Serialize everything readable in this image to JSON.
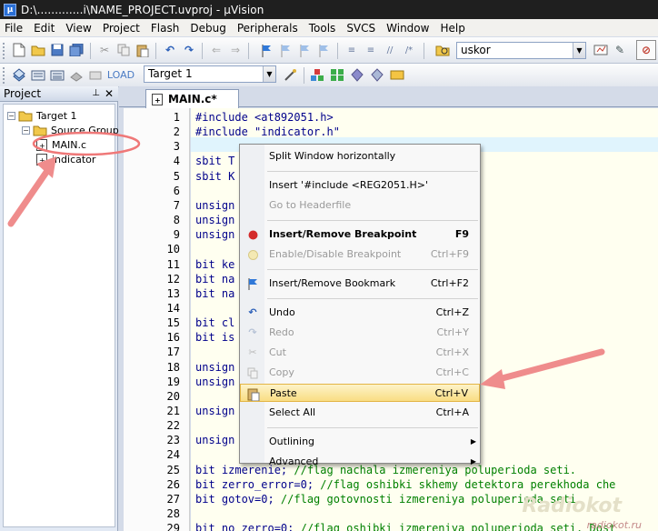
{
  "window": {
    "title": "D:\\.............i\\NAME_PROJECT.uvproj - µVision",
    "app_icon": "µ"
  },
  "menu": [
    "File",
    "Edit",
    "View",
    "Project",
    "Flash",
    "Debug",
    "Peripherals",
    "Tools",
    "SVCS",
    "Window",
    "Help"
  ],
  "toolbar": {
    "search_value": "uskor",
    "target_value": "Target 1"
  },
  "project_pane": {
    "title": "Project",
    "tree": [
      {
        "label": "Target 1",
        "level": 0
      },
      {
        "label": "Source Group",
        "level": 1
      },
      {
        "label": "MAIN.c",
        "level": 2
      },
      {
        "label": "indicator",
        "level": 2
      }
    ]
  },
  "editor": {
    "tab": "MAIN.c*",
    "lines": [
      {
        "n": "1",
        "code": "#include <at892051.h>",
        "comment": ""
      },
      {
        "n": "2",
        "code": "#include \"indicator.h\"",
        "comment": ""
      },
      {
        "n": "3",
        "code": "",
        "comment": ""
      },
      {
        "n": "4",
        "code": "sbit T",
        "comment": ""
      },
      {
        "n": "5",
        "code": "sbit K",
        "comment": ""
      },
      {
        "n": "6",
        "code": "",
        "comment": ""
      },
      {
        "n": "7",
        "code": "unsign",
        "comment": ""
      },
      {
        "n": "8",
        "code": "unsign",
        "comment": ""
      },
      {
        "n": "9",
        "code": "unsign",
        "comment": ""
      },
      {
        "n": "10",
        "code": "",
        "comment": ""
      },
      {
        "n": "11",
        "code": "bit ke",
        "comment": ""
      },
      {
        "n": "12",
        "code": "bit na",
        "comment": ""
      },
      {
        "n": "13",
        "code": "bit na",
        "comment": ""
      },
      {
        "n": "14",
        "code": "",
        "comment": ""
      },
      {
        "n": "15",
        "code": "bit cl",
        "comment": ""
      },
      {
        "n": "16",
        "code": "bit is",
        "comment": ""
      },
      {
        "n": "17",
        "code": "",
        "comment": ""
      },
      {
        "n": "18",
        "code": "unsign",
        "comment": ""
      },
      {
        "n": "19",
        "code": "unsign",
        "comment": ""
      },
      {
        "n": "20",
        "code": "",
        "comment": ""
      },
      {
        "n": "21",
        "code": "unsign",
        "comment": ""
      },
      {
        "n": "22",
        "code": "",
        "comment": ""
      },
      {
        "n": "23",
        "code": "unsign",
        "comment": ""
      },
      {
        "n": "24",
        "code": "",
        "comment": ""
      },
      {
        "n": "25",
        "code": "bit izmerenie; ",
        "comment": "//flag nachala izmereniya poluperioda seti."
      },
      {
        "n": "26",
        "code": "bit zerro_error=0; ",
        "comment": "//flag oshibki skhemy detektora perekhoda che"
      },
      {
        "n": "27",
        "code": "bit gotov=0; ",
        "comment": "//flag gotovnosti izmereniya poluperioda seti."
      },
      {
        "n": "28",
        "code": "",
        "comment": ""
      },
      {
        "n": "29",
        "code": "bit no_zerro=0; ",
        "comment": "//flag oshibki izmereniya poluperioda seti. Dost"
      }
    ]
  },
  "context_menu": [
    {
      "label": "Split Window horizontally",
      "shortcut": "",
      "disabled": false,
      "bold": false,
      "icon": ""
    },
    {
      "sep": true
    },
    {
      "label": "Insert '#include <REG2051.H>'",
      "shortcut": "",
      "disabled": false,
      "bold": false,
      "icon": ""
    },
    {
      "label": "Go to Headerfile",
      "shortcut": "",
      "disabled": true,
      "bold": false,
      "icon": ""
    },
    {
      "sep": true
    },
    {
      "label": "Insert/Remove Breakpoint",
      "shortcut": "F9",
      "disabled": false,
      "bold": true,
      "icon": "breakpoint-icon"
    },
    {
      "label": "Enable/Disable Breakpoint",
      "shortcut": "Ctrl+F9",
      "disabled": true,
      "bold": false,
      "icon": "breakpoint-disabled-icon"
    },
    {
      "sep": true
    },
    {
      "label": "Insert/Remove Bookmark",
      "shortcut": "Ctrl+F2",
      "disabled": false,
      "bold": false,
      "icon": "bookmark-flag-icon"
    },
    {
      "sep": true
    },
    {
      "label": "Undo",
      "shortcut": "Ctrl+Z",
      "disabled": false,
      "bold": false,
      "icon": "undo-icon"
    },
    {
      "label": "Redo",
      "shortcut": "Ctrl+Y",
      "disabled": true,
      "bold": false,
      "icon": "redo-icon"
    },
    {
      "label": "Cut",
      "shortcut": "Ctrl+X",
      "disabled": true,
      "bold": false,
      "icon": "cut-icon"
    },
    {
      "label": "Copy",
      "shortcut": "Ctrl+C",
      "disabled": true,
      "bold": false,
      "icon": "copy-icon"
    },
    {
      "label": "Paste",
      "shortcut": "Ctrl+V",
      "disabled": false,
      "bold": false,
      "icon": "paste-icon",
      "selected": true
    },
    {
      "label": "Select All",
      "shortcut": "Ctrl+A",
      "disabled": false,
      "bold": false,
      "icon": ""
    },
    {
      "sep": true
    },
    {
      "label": "Outlining",
      "shortcut": "",
      "disabled": false,
      "bold": false,
      "icon": "",
      "submenu": true
    },
    {
      "label": "Advanced",
      "shortcut": "",
      "disabled": false,
      "bold": false,
      "icon": "",
      "submenu": true
    }
  ],
  "watermark": {
    "text": "radiokot.ru",
    "logo": "Radiokot"
  },
  "colors": {
    "accent_arrow": "#ef7878",
    "code_keyword": "#00008b",
    "comment": "#008000",
    "menu_highlight": "#f9dd83"
  }
}
